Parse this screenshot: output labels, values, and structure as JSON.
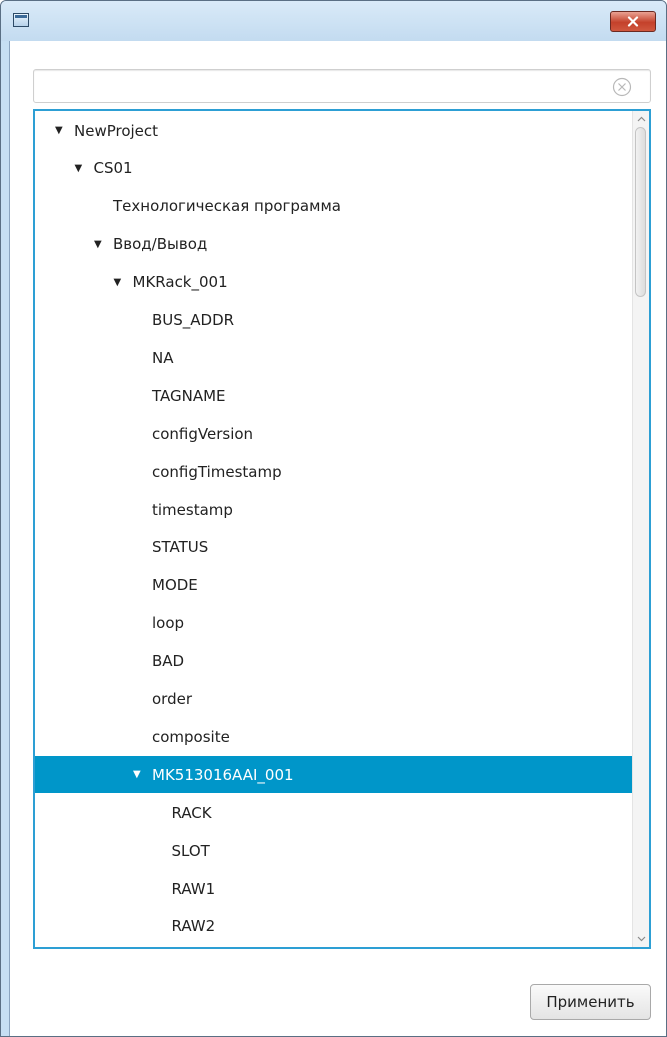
{
  "window": {
    "icon": "window-app-icon",
    "close_icon": "close-x-icon"
  },
  "search": {
    "value": "",
    "placeholder": "",
    "clear_icon": "clear-circle-x-icon"
  },
  "tree": {
    "items": [
      {
        "label": "NewProject",
        "depth": 0,
        "expanded": true
      },
      {
        "label": "CS01",
        "depth": 1,
        "expanded": true
      },
      {
        "label": "Технологическая программа",
        "depth": 2
      },
      {
        "label": "Ввод/Вывод",
        "depth": 2,
        "expanded": true
      },
      {
        "label": "MKRack_001",
        "depth": 3,
        "expanded": true
      },
      {
        "label": "BUS_ADDR",
        "depth": 4
      },
      {
        "label": "NA",
        "depth": 4
      },
      {
        "label": "TAGNAME",
        "depth": 4
      },
      {
        "label": "configVersion",
        "depth": 4
      },
      {
        "label": "configTimestamp",
        "depth": 4
      },
      {
        "label": "timestamp",
        "depth": 4
      },
      {
        "label": "STATUS",
        "depth": 4
      },
      {
        "label": "MODE",
        "depth": 4
      },
      {
        "label": "loop",
        "depth": 4
      },
      {
        "label": "BAD",
        "depth": 4
      },
      {
        "label": "order",
        "depth": 4
      },
      {
        "label": "composite",
        "depth": 4
      },
      {
        "label": "MK513016AAI_001",
        "depth": 4,
        "expanded": true,
        "selected": true
      },
      {
        "label": "RACK",
        "depth": 5
      },
      {
        "label": "SLOT",
        "depth": 5
      },
      {
        "label": "RAW1",
        "depth": 5
      },
      {
        "label": "RAW2",
        "depth": 5
      }
    ],
    "expanded_icon": "triangle-down-icon",
    "selection_color": "#0096c9"
  },
  "buttons": {
    "apply_label": "Применить"
  },
  "colors": {
    "focus_border": "#2d9fd4",
    "close_button": "#c4412b"
  }
}
